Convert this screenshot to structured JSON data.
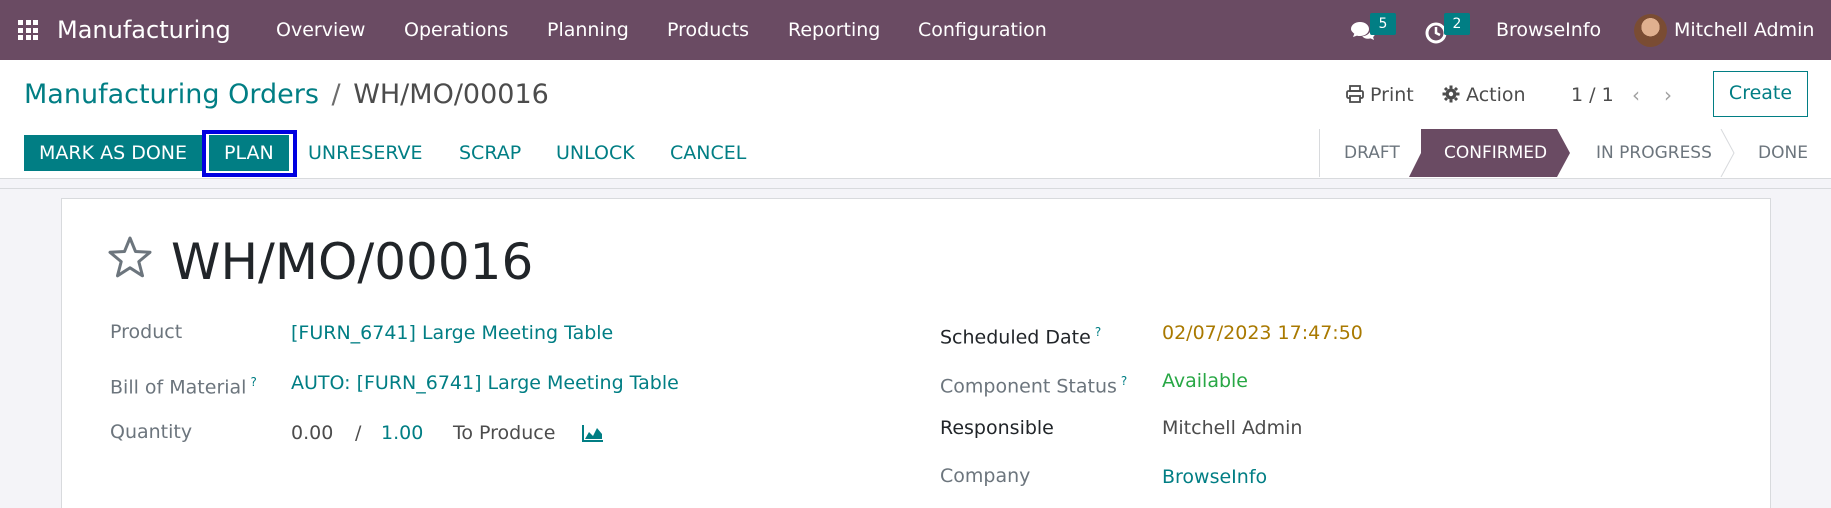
{
  "navbar": {
    "brand": "Manufacturing",
    "menu": [
      "Overview",
      "Operations",
      "Planning",
      "Products",
      "Reporting",
      "Configuration"
    ],
    "messages_count": "5",
    "activities_count": "2",
    "company": "BrowseInfo",
    "user": "Mitchell Admin"
  },
  "breadcrumb": {
    "parent": "Manufacturing Orders",
    "separator": "/",
    "current": "WH/MO/00016"
  },
  "control": {
    "print_label": "Print",
    "action_label": "Action",
    "pager": "1 / 1",
    "create_label": "Create"
  },
  "statusbar": {
    "buttons": [
      "Mark as Done",
      "Plan",
      "Unreserve",
      "Scrap",
      "Unlock",
      "Cancel"
    ],
    "stages": [
      "Draft",
      "Confirmed",
      "In Progress",
      "Done"
    ],
    "active_stage": "Confirmed"
  },
  "record": {
    "title": "WH/MO/00016",
    "fields_left": {
      "product_label": "Product",
      "product_value": "[FURN_6741] Large Meeting Table",
      "bom_label": "Bill of Material",
      "bom_value": "AUTO: [FURN_6741] Large Meeting Table",
      "quantity_label": "Quantity",
      "quantity_done": "0.00",
      "quantity_sep": "/",
      "quantity_total": "1.00",
      "quantity_suffix": "To Produce"
    },
    "fields_right": {
      "scheduled_label": "Scheduled Date",
      "scheduled_value": "02/07/2023 17:47:50",
      "component_label": "Component Status",
      "component_value": "Available",
      "responsible_label": "Responsible",
      "responsible_value": "Mitchell Admin",
      "company_label": "Company",
      "company_value": "BrowseInfo"
    },
    "tooltip_mark": "?"
  },
  "colors": {
    "navbar": "#6a4b63",
    "primary": "#017e84",
    "active_stage": "#6a4b63",
    "highlight": "#0000e0"
  },
  "icons": [
    "apps-grid-icon",
    "chat-icon",
    "clock-icon",
    "print-icon",
    "gear-icon",
    "chevron-left-icon",
    "chevron-right-icon",
    "star-icon",
    "area-chart-icon"
  ]
}
